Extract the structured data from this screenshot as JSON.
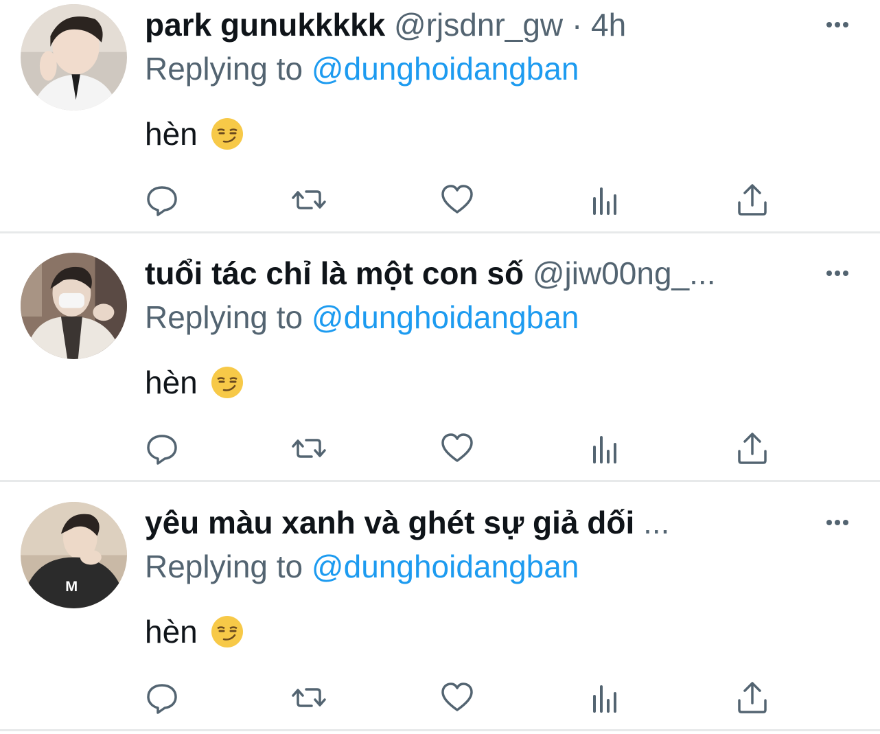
{
  "replies": [
    {
      "display_name": "park gunukkkkk",
      "handle": "@rjsdnr_gw",
      "separator": "·",
      "time": "4h",
      "replying_label": "Replying to",
      "mention": "@dunghoidangban",
      "text": "hèn",
      "emoji_icon": "smirking-face-icon"
    },
    {
      "display_name": "tuổi tác chỉ là một con số",
      "handle": "@jiw00ng_...",
      "separator": "",
      "time": "",
      "replying_label": "Replying to",
      "mention": "@dunghoidangban",
      "text": "hèn",
      "emoji_icon": "smirking-face-icon"
    },
    {
      "display_name": "yêu màu xanh và ghét sự giả dối",
      "handle": " ...",
      "separator": "",
      "time": "",
      "replying_label": "Replying to",
      "mention": "@dunghoidangban",
      "text": "hèn",
      "emoji_icon": "smirking-face-icon"
    }
  ],
  "action_icons": [
    "reply-icon",
    "retweet-icon",
    "like-icon",
    "analytics-icon",
    "share-icon"
  ],
  "colors": {
    "text": "#0f1419",
    "secondary": "#536471",
    "link": "#1d9bf0",
    "divider": "#e7e9ea"
  }
}
